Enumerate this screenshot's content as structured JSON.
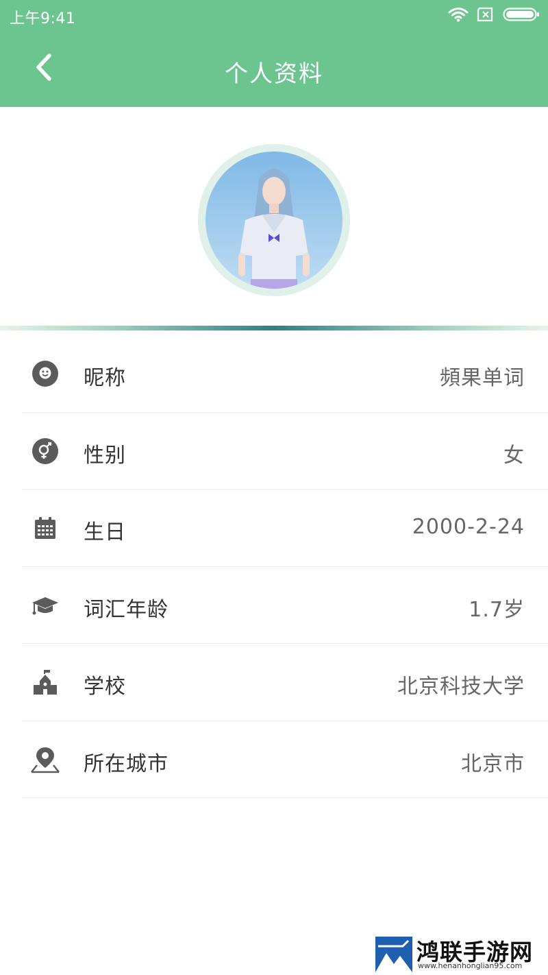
{
  "status_bar": {
    "time": "上午9:41",
    "icons": [
      "wifi-icon",
      "sim-error-icon",
      "battery-icon"
    ]
  },
  "app_bar": {
    "title": "个人资料",
    "back_icon": "chevron-left-icon"
  },
  "profile": {
    "avatar": "avatar-photo"
  },
  "fields": [
    {
      "label": "昵称",
      "value": "頻果单词",
      "icon": "smiley-icon"
    },
    {
      "label": "性别",
      "value": "女",
      "icon": "gender-icon"
    },
    {
      "label": "生日",
      "value": "2000-2-24",
      "icon": "calendar-icon"
    },
    {
      "label": "词汇年龄",
      "value": "1.7岁",
      "icon": "graduation-cap-icon"
    },
    {
      "label": "学校",
      "value": "北京科技大学",
      "icon": "school-icon"
    },
    {
      "label": "所在城市",
      "value": "北京市",
      "icon": "location-pin-icon"
    }
  ],
  "watermark": {
    "title": "鸿联手游网",
    "url": "www.henanhonglian95.com"
  },
  "colors": {
    "primary": "#6cc48f",
    "icon_gray": "#5b5b5b",
    "label": "#333333",
    "value": "#666666"
  }
}
